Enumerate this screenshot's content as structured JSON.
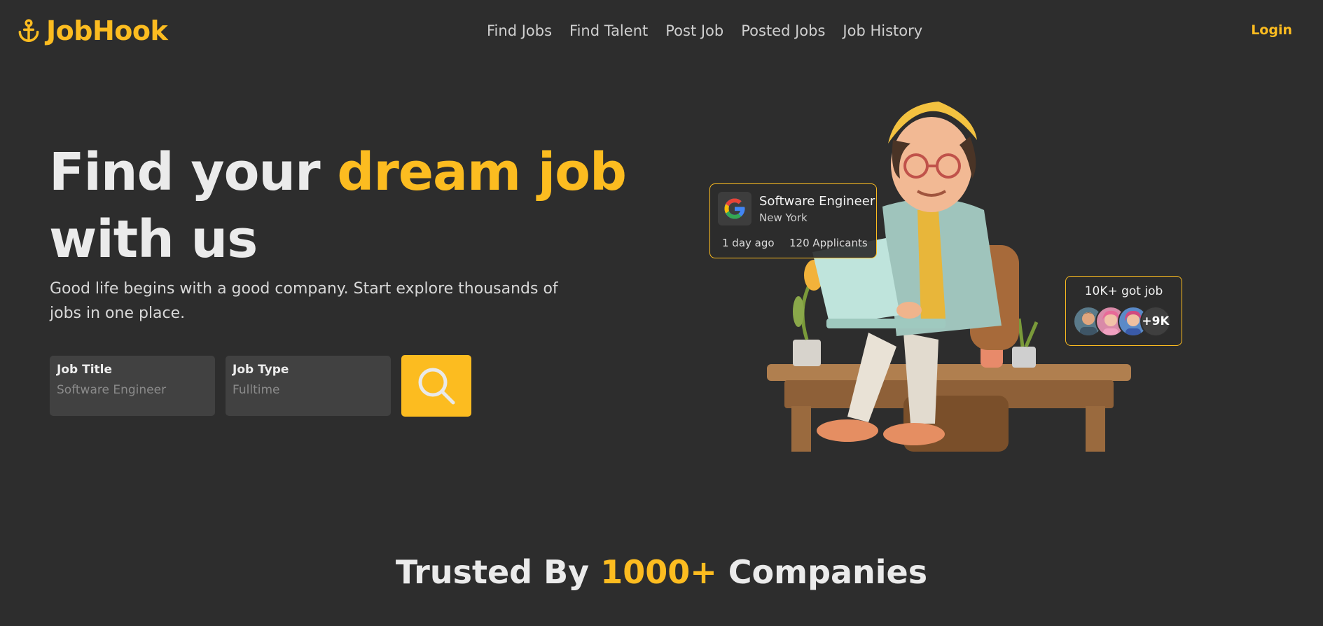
{
  "header": {
    "logo_text": "JobHook",
    "nav": [
      "Find Jobs",
      "Find Talent",
      "Post Job",
      "Posted Jobs",
      "Job History"
    ],
    "login_label": "Login"
  },
  "hero": {
    "title_part1": "Find your ",
    "title_accent": "dream job",
    "title_part2": "with us",
    "subtitle": "Good life begins with a good company. Start explore thousands of jobs in one place."
  },
  "search": {
    "job_title_label": "Job Title",
    "job_title_placeholder": "Software Engineer",
    "job_type_label": "Job Type",
    "job_type_placeholder": "Fulltime",
    "button_icon": "search-icon"
  },
  "job_card": {
    "company_icon": "google-logo-icon",
    "title": "Software Engineer",
    "location": "New York",
    "posted": "1 day ago",
    "applicants": "120 Applicants"
  },
  "stat_card": {
    "label": "10K+ got job",
    "more_count": "+9K"
  },
  "trusted": {
    "prefix": "Trusted By ",
    "accent": "1000+",
    "suffix": " Companies"
  },
  "colors": {
    "background": "#2d2d2d",
    "accent": "#fcbc20",
    "field_bg": "#414141"
  }
}
